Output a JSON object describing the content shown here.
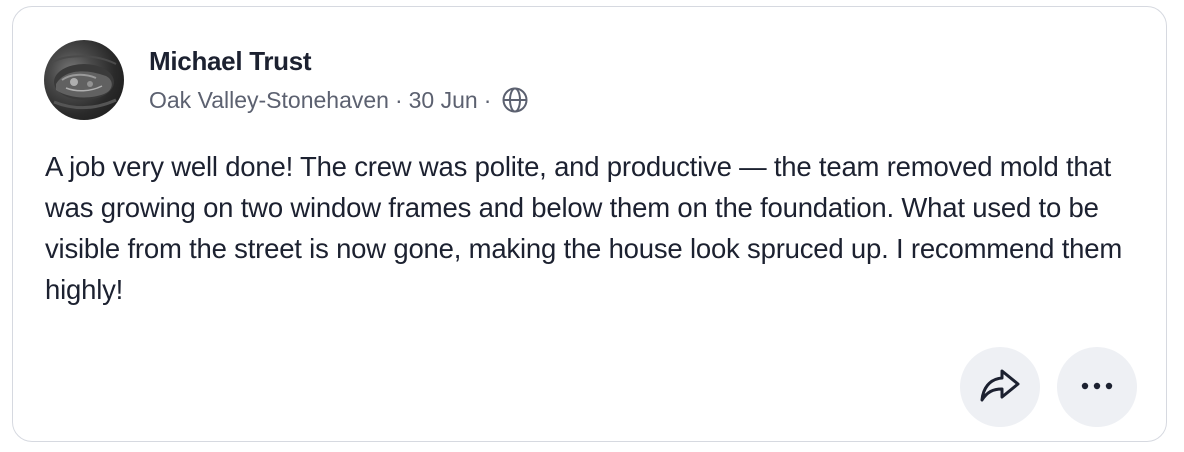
{
  "review": {
    "author_name": "Michael Trust",
    "location": "Oak Valley-Stonehaven",
    "separator": "·",
    "date": "30 Jun",
    "visibility_icon": "globe-icon",
    "text": "A job very well done! The crew was polite, and productive — the team removed mold that was growing on two window frames and below them on the foundation. What used to be visible from the street is now gone, making the house look spruced up. I recommend them highly!"
  },
  "actions": {
    "share_icon": "share-arrow-icon",
    "more_icon": "more-dots-icon"
  },
  "colors": {
    "text_primary": "#1c2130",
    "text_secondary": "#5c6170",
    "button_bg": "#eef0f4",
    "card_border": "#d6d9e0"
  }
}
